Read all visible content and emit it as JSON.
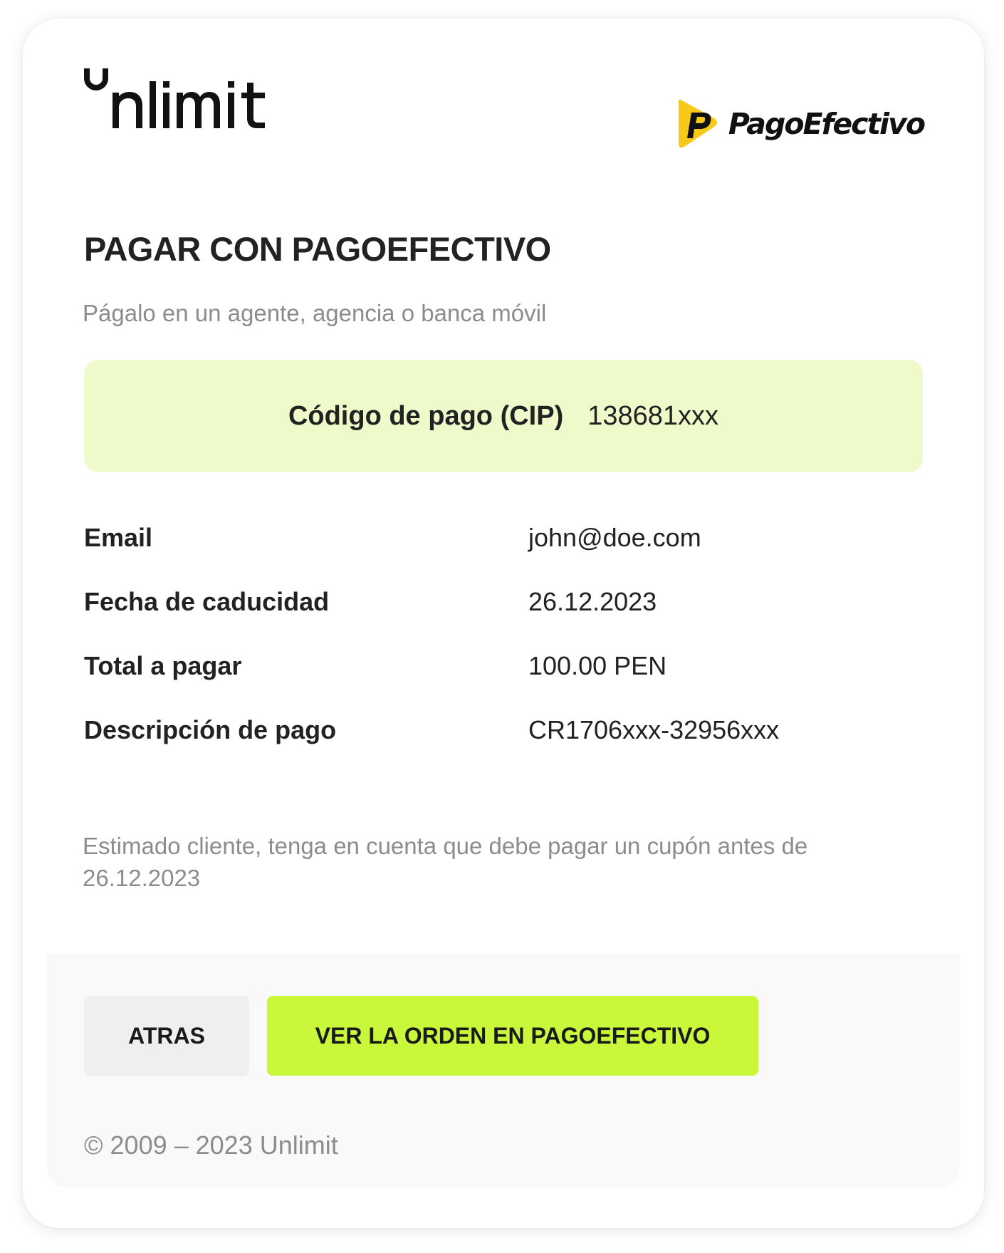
{
  "header": {
    "brand_logo": "Unlimit",
    "partner_logo": "PagoEfectivo",
    "brand_color": "#111111",
    "partner_mark_color": "#f7c91a"
  },
  "title": "PAGAR CON PAGOEFECTIVO",
  "subtitle": "Págalo en un agente, agencia o banca móvil",
  "cip": {
    "label": "Código de pago (CIP)",
    "value": "138681xxx",
    "background_color": "#eefac9"
  },
  "details": [
    {
      "label": "Email",
      "value": "john@doe.com"
    },
    {
      "label": "Fecha de caducidad",
      "value": "26.12.2023"
    },
    {
      "label": "Total a pagar",
      "value": "100.00 PEN"
    },
    {
      "label": "Descripción de pago",
      "value": "CR1706xxx-32956xxx"
    }
  ],
  "notice": "Estimado cliente, tenga en cuenta que debe pagar un cupón antes de 26.12.2023",
  "buttons": {
    "back_label": "ATRAS",
    "order_label": "VER LA ORDEN EN PAGOEFECTIVO",
    "order_color": "#c9f73a"
  },
  "footer": {
    "copyright": "© 2009 – 2023 Unlimit"
  }
}
